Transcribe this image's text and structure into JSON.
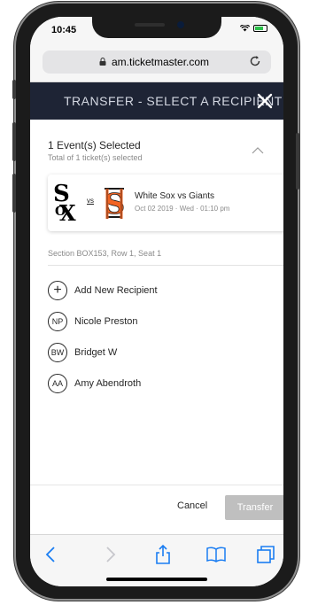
{
  "status_bar": {
    "time": "10:45"
  },
  "browser": {
    "url": "am.ticketmaster.com"
  },
  "modal": {
    "title": "TRANSFER - SELECT A RECIPIENT"
  },
  "selection": {
    "event_count": "1 Event(s) Selected",
    "ticket_count": "Total of 1 ticket(s) selected"
  },
  "event": {
    "vs_label": "vs",
    "name": "White Sox vs Giants",
    "date": "Oct 02 2019 · Wed · 01:10 pm"
  },
  "seat": "Section BOX153, Row 1, Seat 1",
  "recipients": [
    {
      "initials": "+",
      "label": "Add New Recipient"
    },
    {
      "initials": "NP",
      "label": "Nicole Preston"
    },
    {
      "initials": "BW",
      "label": "Bridget W"
    },
    {
      "initials": "AA",
      "label": "Amy Abendroth"
    }
  ],
  "actions": {
    "cancel": "Cancel",
    "transfer": "Transfer"
  },
  "colors": {
    "header_bg": "#1e2435",
    "giants_orange": "#f26424",
    "ios_blue": "#1a7df2",
    "disabled_button": "#bfbfbf"
  },
  "icons": {
    "lock": "lock-icon",
    "reload": "reload-icon",
    "close": "close-icon",
    "chevron": "chevron-up-icon",
    "back": "back-icon",
    "forward": "forward-icon",
    "share": "share-icon",
    "bookmarks": "bookmarks-icon",
    "tabs": "tabs-icon"
  }
}
